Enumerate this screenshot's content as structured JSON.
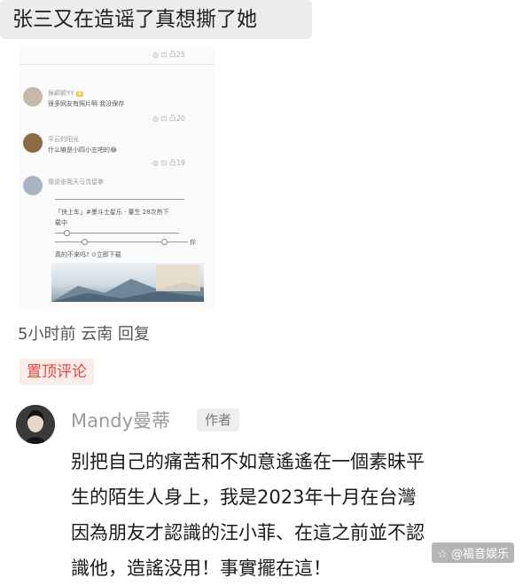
{
  "header_comment": "张三又在造谣了真想撕了她",
  "screenshot": {
    "top_row_icons": "◎  ⊡  凸25",
    "comment1": {
      "user": "侯颖颖YY",
      "text": "很多网友有照片啊 我没保存",
      "icons": "◎  ⊡  凸20"
    },
    "comment2": {
      "user": "平云的阳光",
      "text": "什么嘛是小四小五吧的😂",
      "icons": "◎  ⊡  凸19"
    },
    "comment3": {
      "user": "我说张我天马流星拳"
    },
    "card_line1": "「快上车」#墨斗士星乐 · 董生 28次热下",
    "card_line2": "载中",
    "card_line3": "真的不来吗?  ⊙立即下载",
    "card_you": "你"
  },
  "meta": {
    "time": "5小时前",
    "location": "云南",
    "reply": "回复"
  },
  "pinned_label": "置顶评论",
  "comment": {
    "username": "Mandy曼蒂",
    "badge": "作者",
    "lines": [
      "别把自己的痛苦和不如意遙遙在一個素昧平",
      "生的陌生人身上，我是2023年十月在台灣",
      "因為朋友才認識的汪小菲、在這之前並不認",
      "識他，造謠没用！事實擺在這！"
    ]
  },
  "watermark": "☆ @福音娱乐",
  "colors": {
    "pinned_red": "#e2473b",
    "pinned_bg": "#fdecec",
    "gray_text": "#9a9a9a"
  }
}
